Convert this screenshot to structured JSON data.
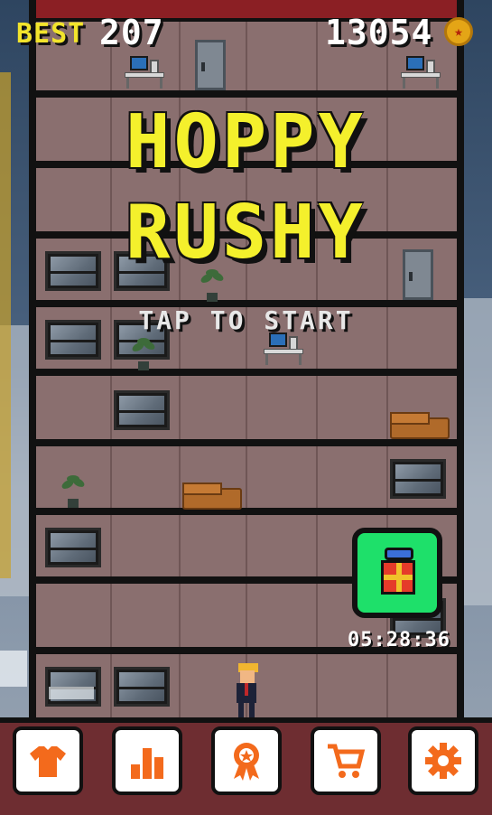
{
  "hud": {
    "best_label": "BEST",
    "best_value": "207",
    "coins": "13054",
    "coin_icon": "coin-icon"
  },
  "title": {
    "line1": "HOPPY",
    "line2": "RUSHY",
    "tap_to_start": "TAP TO START"
  },
  "gift": {
    "icon": "gift-icon",
    "timer": "05:28:36"
  },
  "menu": [
    {
      "name": "shop-skins-button",
      "icon": "shirt-icon"
    },
    {
      "name": "leaderboard-button",
      "icon": "bar-chart-icon"
    },
    {
      "name": "achievements-button",
      "icon": "ribbon-badge-icon"
    },
    {
      "name": "store-button",
      "icon": "cart-icon"
    },
    {
      "name": "settings-button",
      "icon": "gear-icon"
    }
  ],
  "colors": {
    "title_yellow": "#f4f02c",
    "accent_orange": "#f36a1c",
    "gift_green": "#1ee06a",
    "bottom_bar": "#6e2d31"
  }
}
